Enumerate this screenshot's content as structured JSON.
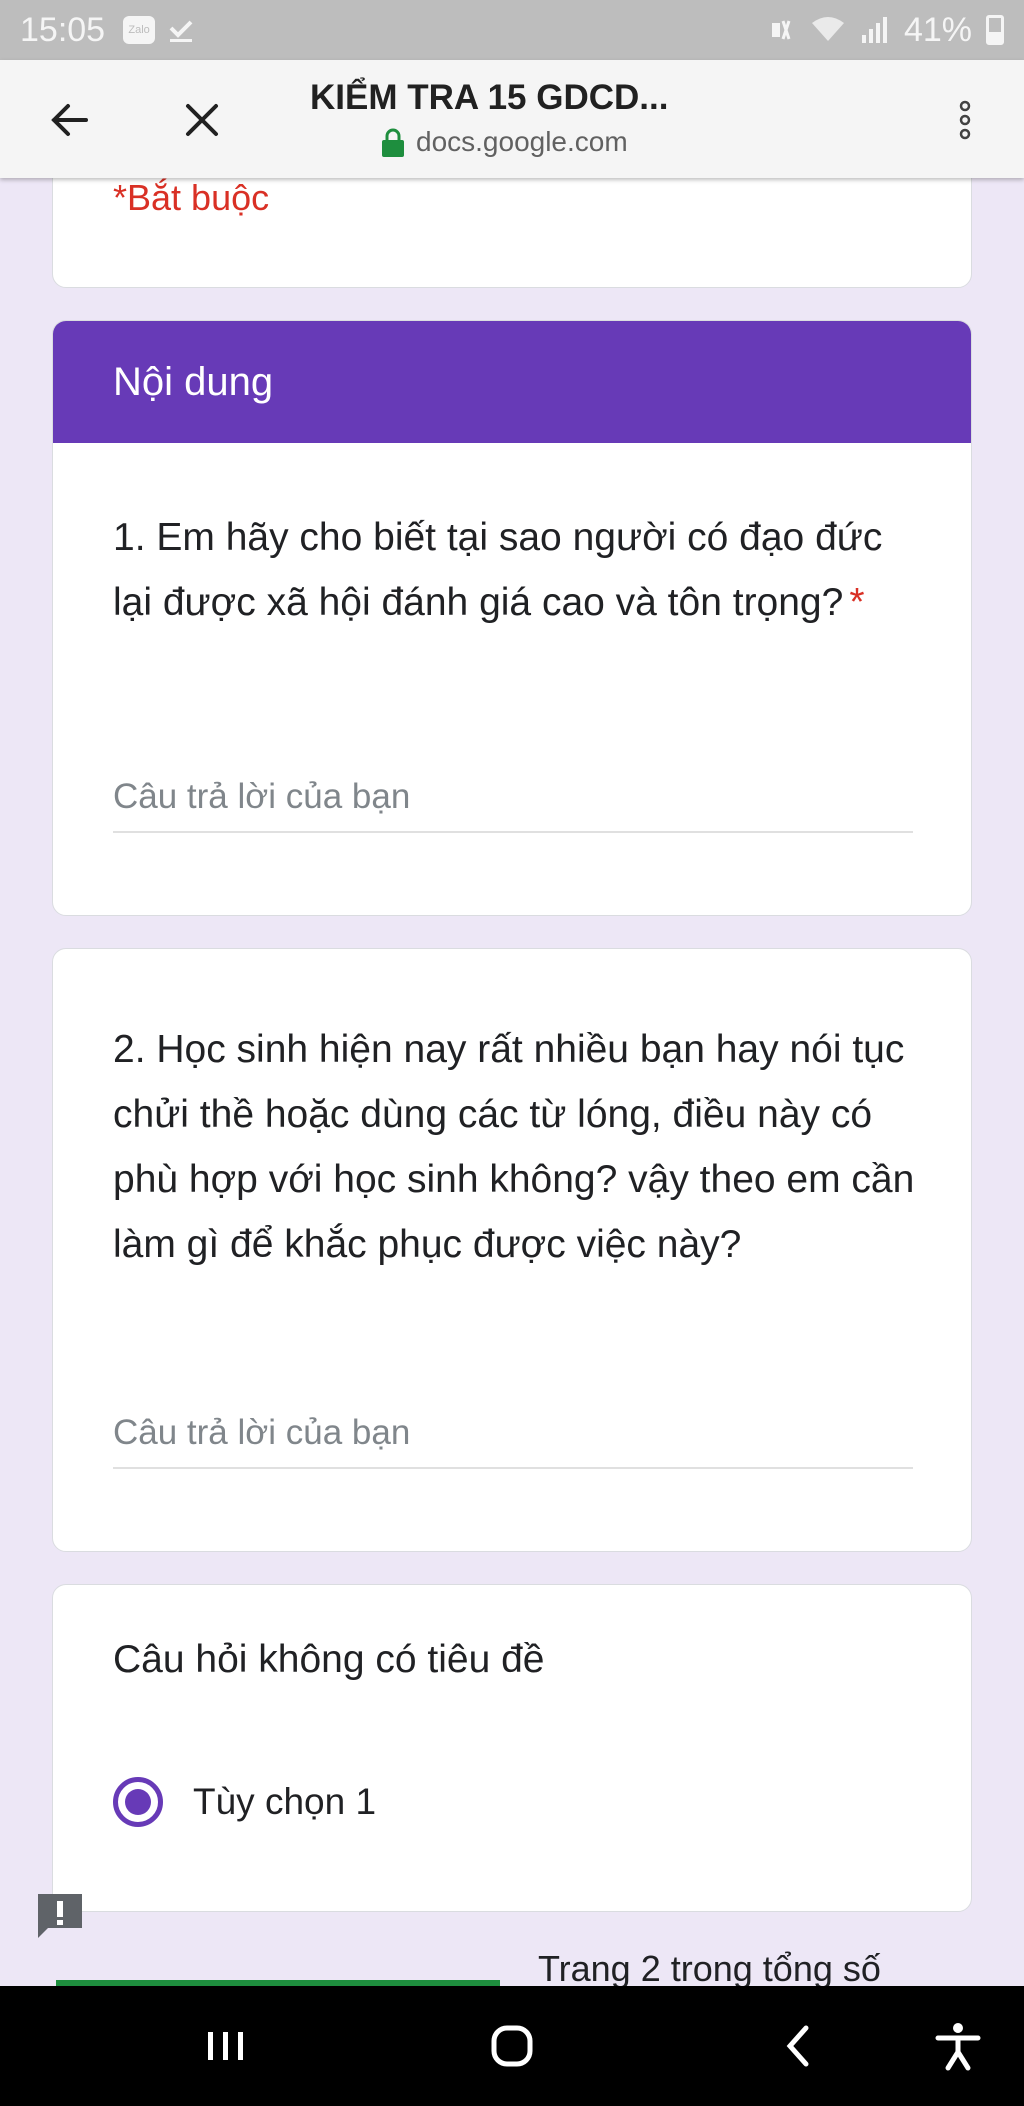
{
  "status_bar": {
    "time": "15:05",
    "zalo_label": "Zalo",
    "battery": "41%",
    "icons": [
      "zalo-icon",
      "download-done-icon",
      "mute-icon",
      "wifi-icon",
      "signal-icon",
      "battery-icon"
    ]
  },
  "browser": {
    "title": "KIỂM TRA 15 GDCD...",
    "url": "docs.google.com",
    "icons": [
      "back-arrow-icon",
      "close-icon",
      "lock-icon",
      "more-vert-icon"
    ]
  },
  "form": {
    "required_note": "*Bắt buộc",
    "section_title": "Nội dung",
    "questions": [
      {
        "text": "1. Em hãy cho biết tại sao người có đạo đức lại được xã hội đánh giá cao và tôn trọng?",
        "required_mark": "*",
        "answer_placeholder": "Câu trả lời của bạn"
      },
      {
        "text": "2. Học sinh hiện nay rất nhiều bạn hay nói tục chửi thề hoặc dùng các từ lóng, điều này có phù hợp với học sinh không? vậy theo em cần làm gì để khắc phục được việc này?",
        "answer_placeholder": "Câu trả lời của bạn"
      },
      {
        "text": "Câu hỏi không có tiêu đề",
        "option_label": "Tùy chọn 1",
        "option_selected": true
      }
    ],
    "page_info": "Trang 2 trong tổng số"
  },
  "colors": {
    "accent": "#673ab7",
    "required": "#d93025",
    "background": "#ede7f6"
  },
  "nav_icons": [
    "recent-apps-icon",
    "home-icon",
    "back-icon",
    "accessibility-icon"
  ]
}
